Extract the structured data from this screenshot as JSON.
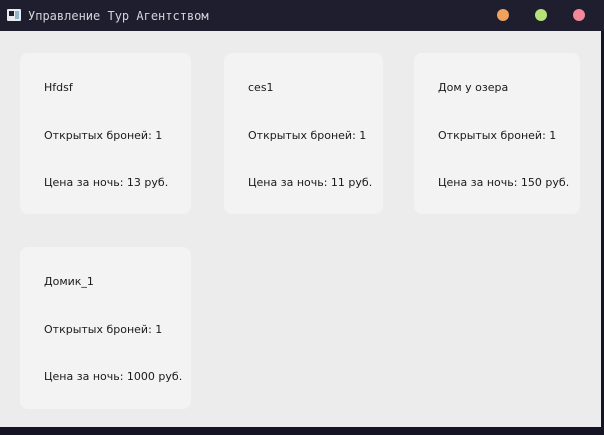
{
  "window": {
    "title": "Управление Тур Агентством",
    "controls": {
      "minimize_color": "#f0a15e",
      "maximize_color": "#b6e27a",
      "close_color": "#f2889a"
    }
  },
  "cards": [
    {
      "name": "Hfdsf",
      "bookings": "Открытых броней: 1",
      "price": "Цена за ночь: 13 руб."
    },
    {
      "name": "ces1",
      "bookings": "Открытых броней: 1",
      "price": "Цена за ночь: 11 руб."
    },
    {
      "name": "Дом у озера",
      "bookings": "Открытых броней: 1",
      "price": "Цена за ночь: 150 руб."
    },
    {
      "name": "Домик_1",
      "bookings": "Открытых броней: 1",
      "price": "Цена за ночь: 1000 руб."
    }
  ]
}
